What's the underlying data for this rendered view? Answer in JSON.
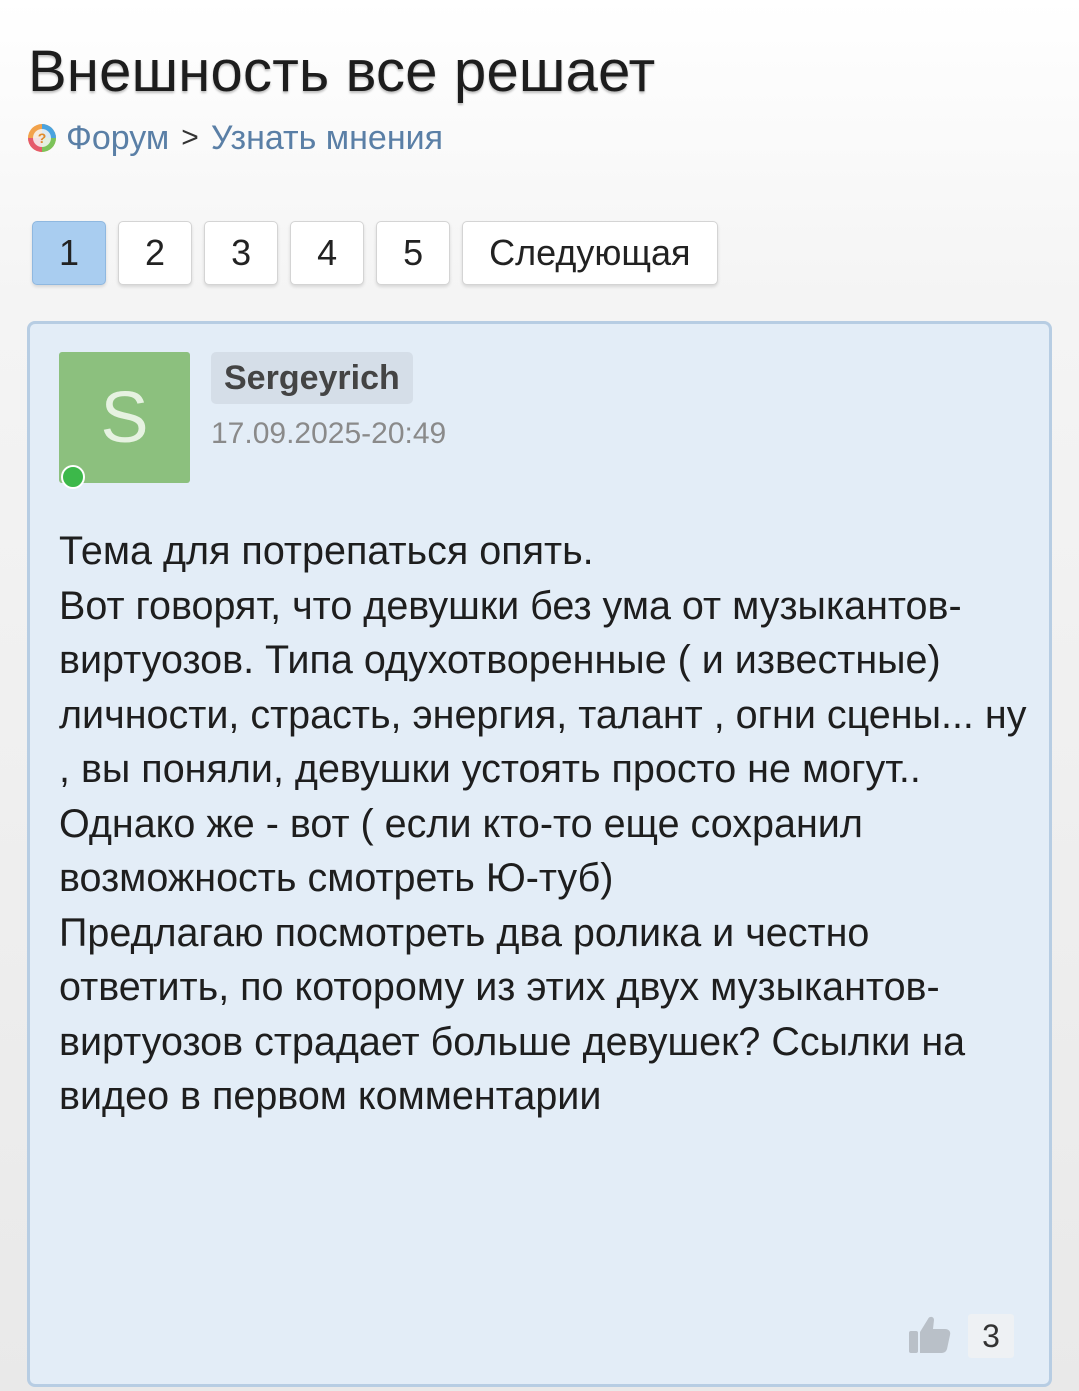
{
  "page": {
    "title": "Внешность все решает"
  },
  "breadcrumb": {
    "forum_label": "Форум",
    "separator": ">",
    "section_label": "Узнать мнения"
  },
  "pagination": {
    "pages": [
      "1",
      "2",
      "3",
      "4",
      "5"
    ],
    "current": "1",
    "next_label": "Следующая"
  },
  "post": {
    "avatar_letter": "S",
    "author": "Sergeyrich",
    "timestamp": "17.09.2025-20:49",
    "online": true,
    "body_lines": [
      "Тема для потрепаться опять.",
      "Вот говорят, что девушки без ума от музыкантов-виртуозов. Типа одухотворенные ( и известные) личности, страсть, энергия, талант , огни сцены... ну , вы поняли, девушки устоять просто не могут.. Однако же - вот ( если кто-то еще сохранил возможность смотреть Ю-туб)",
      "Предлагаю посмотреть два ролика и честно ответить, по которому из этих двух музыкантов-виртуозов страдает больше девушек? Ссылки на видео в первом комментарии"
    ],
    "likes": "3"
  },
  "colors": {
    "accent_link": "#5a7fa6",
    "active_page": "#a9cdf0",
    "post_background": "#e3edf7",
    "avatar_background": "#8cc07e",
    "online_indicator": "#3cb84a"
  },
  "icons": {
    "forum": "forum-logo-icon",
    "like": "thumbs-up-icon"
  }
}
